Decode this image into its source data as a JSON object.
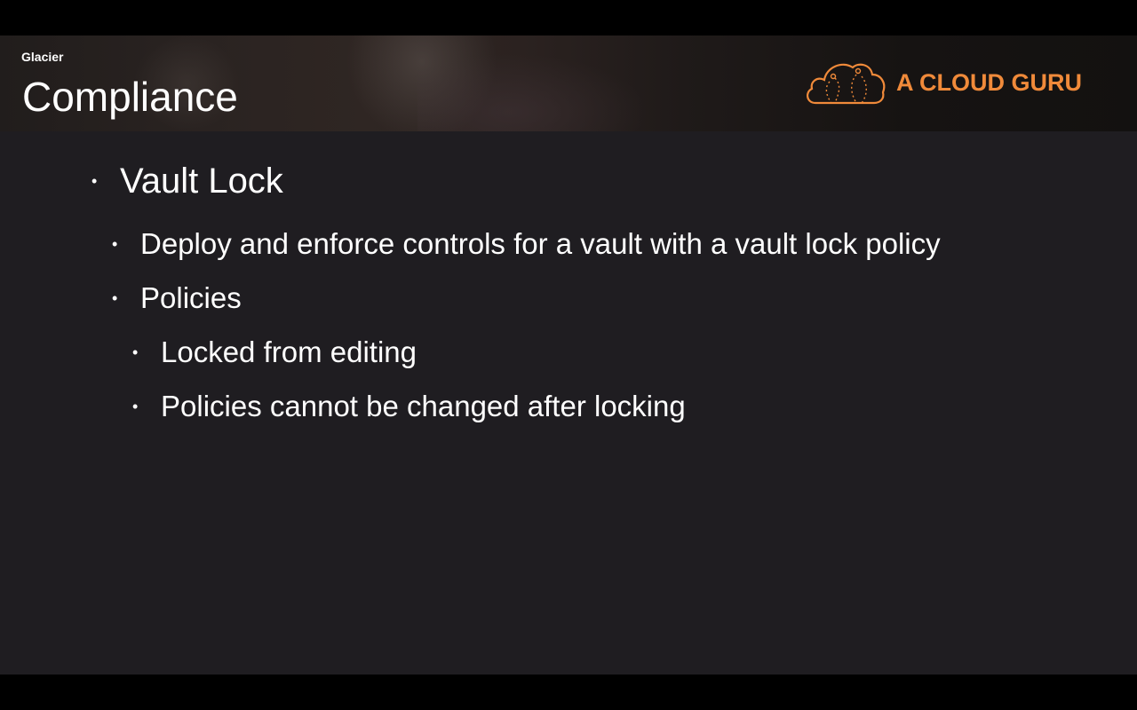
{
  "slide": {
    "section": "Glacier",
    "title": "Compliance",
    "logo": {
      "text": "A CLOUD GURU",
      "icon": "cloud-logo-icon",
      "color": "#f08a3a"
    },
    "bullets": [
      {
        "level": 1,
        "text": "Vault Lock"
      },
      {
        "level": 2,
        "text": "Deploy and enforce controls for a vault with a vault lock policy"
      },
      {
        "level": 2,
        "text": "Policies"
      },
      {
        "level": 3,
        "text": "Locked from editing"
      },
      {
        "level": 3,
        "text": "Policies cannot be changed after locking"
      }
    ],
    "bullet_icon": "bullet-dot-icon",
    "colors": {
      "background": "#1f1d21",
      "text": "#ffffff",
      "accent": "#f08a3a"
    }
  }
}
